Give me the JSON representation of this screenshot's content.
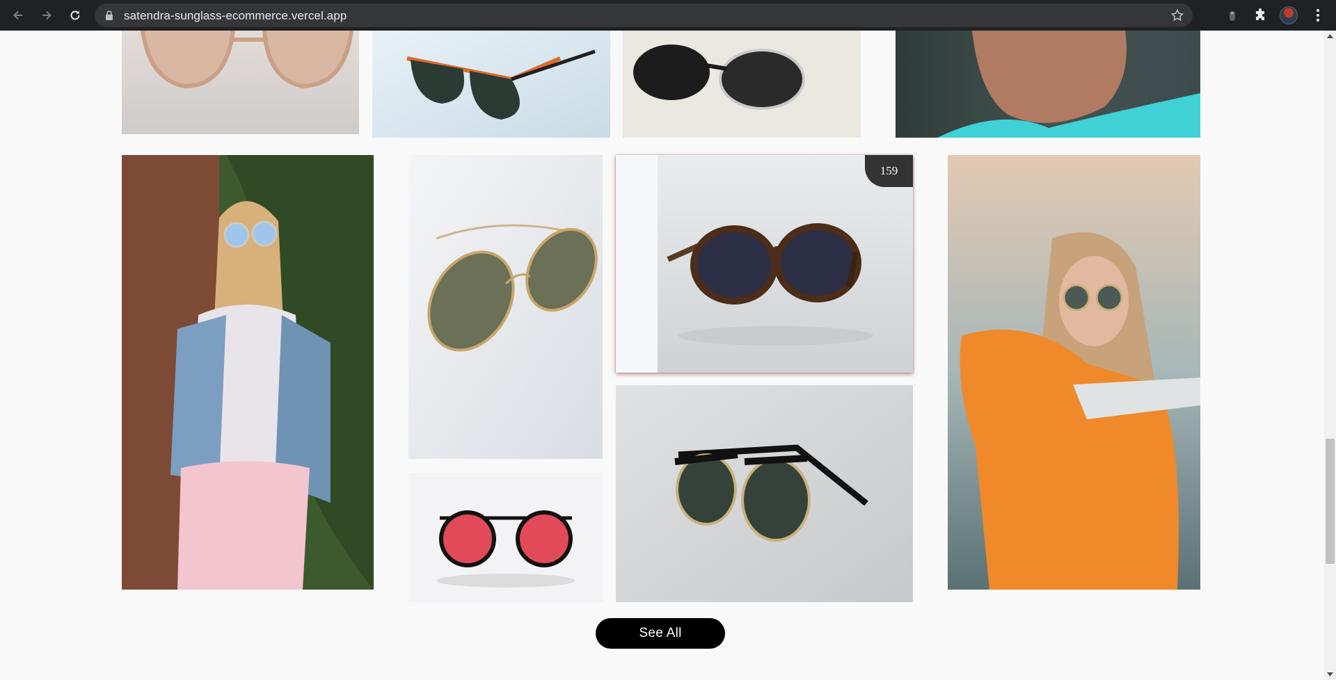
{
  "browser": {
    "url": "satendra-sunglass-ecommerce.vercel.app",
    "icons": {
      "back": "back-arrow-icon",
      "forward": "forward-arrow-icon",
      "reload": "reload-icon",
      "lock": "lock-icon",
      "bookmark": "star-icon",
      "extension1": "extension-icon",
      "extensions": "puzzle-icon",
      "profile": "avatar",
      "menu": "kebab-menu-icon"
    }
  },
  "gallery": {
    "featured_price": "159",
    "photos": [
      "Beige-frame sunglasses",
      "Black sunglasses with orange trim",
      "Black clubmaster sunglasses on white cloth",
      "Man wearing teal t-shirt",
      "Woman in denim jacket wearing round blue sunglasses",
      "Gold round metal sunglasses",
      "Tortoiseshell round sunglasses",
      "Woman in orange hoodie wearing round sunglasses",
      "Red mirrored aviator sunglasses",
      "Black clubmaster sunglasses"
    ]
  },
  "cta": {
    "label": "See All"
  },
  "colors": {
    "page_bg": "#f9f9f9",
    "button_bg": "#000000",
    "badge_bg": "#333333",
    "chrome_bg": "#202124"
  }
}
